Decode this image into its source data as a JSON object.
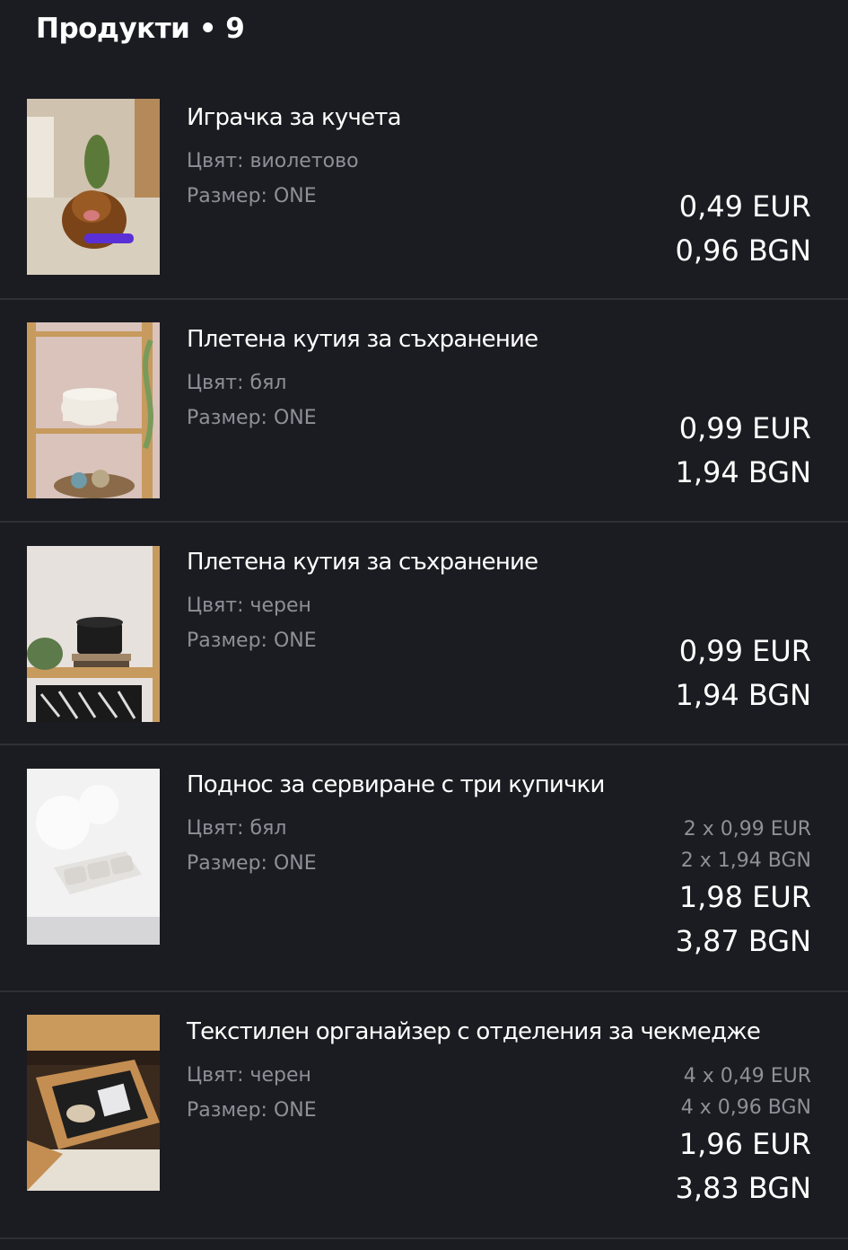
{
  "header": {
    "title": "Продукти • 9"
  },
  "labels": {
    "color": "Цвят:",
    "size": "Размер:"
  },
  "items": [
    {
      "title": "Играчка за кучета",
      "color": "виолетово",
      "size": "ONE",
      "price_eur": "0,49 EUR",
      "price_bgn": "0,96 BGN",
      "image": "dog-toy-photo"
    },
    {
      "title": "Плетена кутия за съхранение",
      "color": "бял",
      "size": "ONE",
      "price_eur": "0,99 EUR",
      "price_bgn": "1,94 BGN",
      "image": "white-basket-photo"
    },
    {
      "title": "Плетена кутия за съхранение",
      "color": "черен",
      "size": "ONE",
      "price_eur": "0,99 EUR",
      "price_bgn": "1,94 BGN",
      "image": "black-basket-photo"
    },
    {
      "title": "Поднос за сервиране с три купички",
      "color": "бял",
      "size": "ONE",
      "unit_eur": "2 x 0,99 EUR",
      "unit_bgn": "2 x 1,94 BGN",
      "price_eur": "1,98 EUR",
      "price_bgn": "3,87 BGN",
      "image": "serving-tray-photo"
    },
    {
      "title": "Текстилен органайзер с отделения за чекмедже",
      "color": "черен",
      "size": "ONE",
      "unit_eur": "4 x 0,49 EUR",
      "unit_bgn": "4 x 0,96 BGN",
      "price_eur": "1,96 EUR",
      "price_bgn": "3,83 BGN",
      "image": "drawer-organizer-photo"
    }
  ]
}
